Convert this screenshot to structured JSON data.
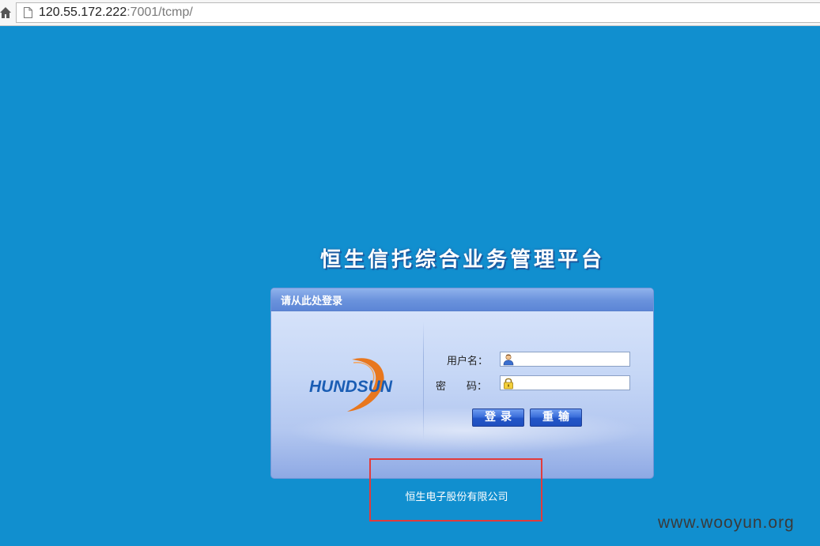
{
  "browser": {
    "url_host": "120.55.172.222",
    "url_rest": ":7001/tcmp/"
  },
  "page": {
    "title": "恒生信托综合业务管理平台"
  },
  "login": {
    "header": "请从此处登录",
    "logo_text": "HUNDSUN",
    "username_label": "用户名：",
    "password_label": "密　　码：",
    "username_value": "",
    "password_value": "",
    "login_button": "登录",
    "reset_button": "重输"
  },
  "footer": {
    "company": "恒生电子股份有限公司"
  },
  "watermark": "www.wooyun.org",
  "colors": {
    "background": "#118fcf",
    "highlight": "#e23b3b"
  }
}
